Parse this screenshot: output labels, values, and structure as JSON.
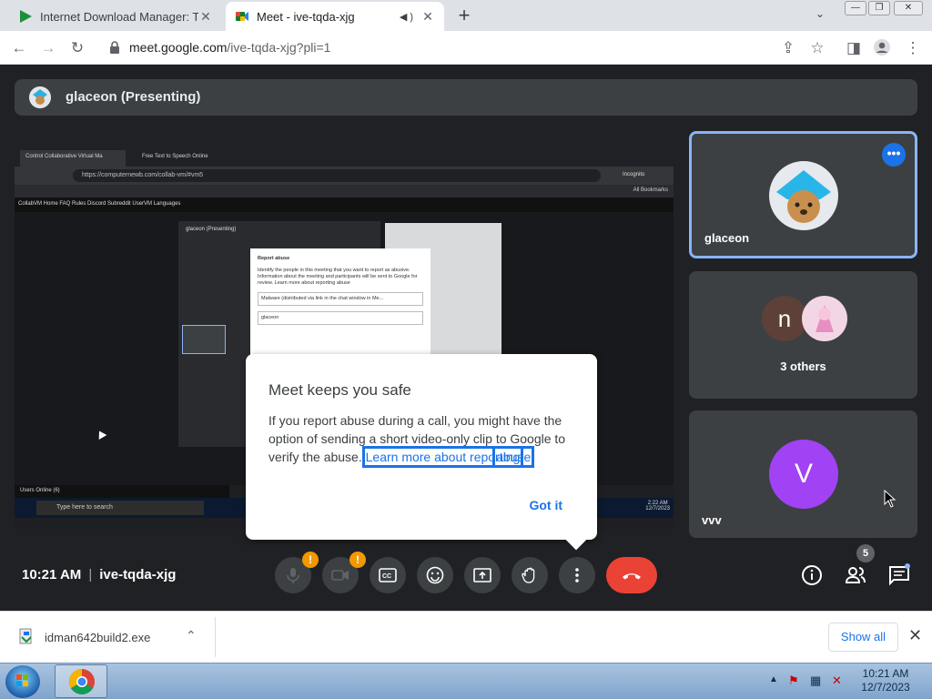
{
  "browser": {
    "tabs": [
      {
        "title": "Internet Download Manager: The",
        "active": false
      },
      {
        "title": "Meet - ive-tqda-xjg",
        "active": true
      }
    ],
    "url_host": "meet.google.com",
    "url_path": "/ive-tqda-xjg?pli=1"
  },
  "presenter": {
    "label": "glaceon (Presenting)"
  },
  "shared_screen": {
    "tab1": "Control Collaborative Virtual Ma",
    "tab2": "Free Text to Speech Online",
    "url": "https://computernewb.com/collab-vm/#vm5",
    "incognito": "Incognito",
    "all_bookmarks": "All Bookmarks",
    "nav": "CollabVM   Home   FAQ   Rules   Discord   Subreddit   UserVM   Languages",
    "meet_label": "glaceon (Presenting)",
    "dialog_title": "Report abuse",
    "dialog_text": "Identify the people in this meeting that you want to report as abusive. Information about the meeting and participants will be sent to Google for review. Learn more about reporting abuse",
    "dialog_select": "Malware (distributed via link in the chat window in Me...",
    "dialog_field": "glaceon",
    "users_online": "Users Online (6)",
    "search_placeholder": "Type here to search",
    "time": "2:22 AM",
    "date": "12/7/2023"
  },
  "tiles": [
    {
      "name": "glaceon"
    },
    {
      "name": "3 others",
      "letter": "n"
    },
    {
      "name": "vvv",
      "letter": "V"
    }
  ],
  "dialog": {
    "title": "Meet keeps you safe",
    "body": "If you report abuse during a call, you might have the option of sending a short video-only clip to Google to verify the abuse.",
    "link_part1": "Learn more about reporting",
    "link_part2": "abuse",
    "button": "Got it"
  },
  "bottom_bar": {
    "time": "10:21 AM",
    "meeting_code": "ive-tqda-xjg",
    "participants_count": "5",
    "warning": "!"
  },
  "downloads": {
    "file": "idman642build2.exe",
    "show_all": "Show all"
  },
  "taskbar": {
    "time": "10:21 AM",
    "date": "12/7/2023"
  },
  "colors": {
    "meet_bg": "#202124",
    "tile_bg": "#3c4043",
    "accent_blue": "#1a73e8",
    "highlight_border": "#8ab4f8",
    "end_call_red": "#ea4335",
    "warning_orange": "#f29900",
    "avatar_n": "#5d4037",
    "avatar_v": "#a142f4"
  }
}
